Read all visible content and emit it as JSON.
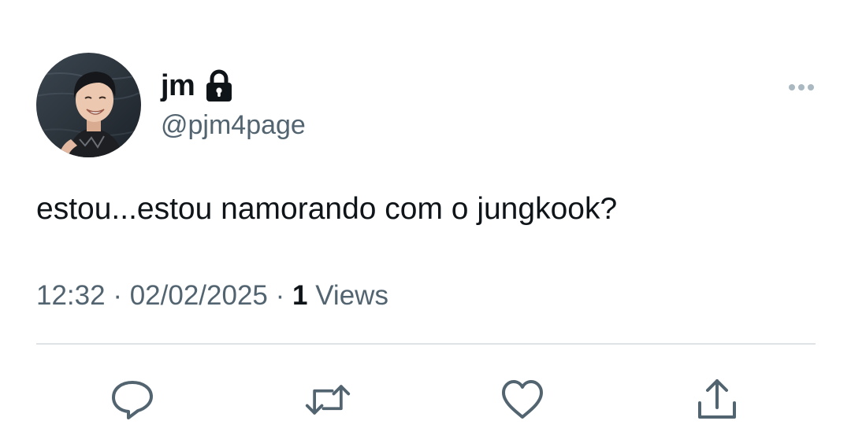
{
  "tweet": {
    "author": {
      "display_name": "jm",
      "handle": "@pjm4page",
      "protected_icon": "lock-icon",
      "avatar": "profile-photo"
    },
    "more_icon": "more-horizontal-icon",
    "text": "estou...estou namorando com o jungkook?",
    "time": "12:32",
    "separator": "·",
    "date": "02/02/2025",
    "views_count": "1",
    "views_label": "Views",
    "actions": [
      {
        "name": "reply",
        "icon": "reply-icon"
      },
      {
        "name": "retweet",
        "icon": "retweet-icon"
      },
      {
        "name": "like",
        "icon": "heart-icon"
      },
      {
        "name": "share",
        "icon": "share-icon"
      }
    ]
  },
  "colors": {
    "text_primary": "#0f1419",
    "text_secondary": "#536471",
    "divider": "#dfe3e6",
    "icon": "#536471"
  }
}
